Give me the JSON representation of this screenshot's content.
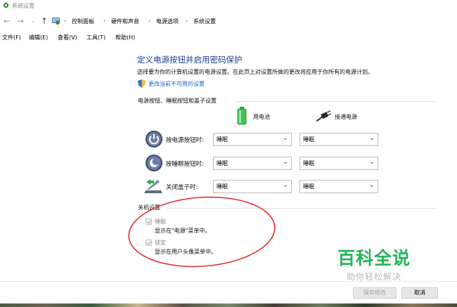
{
  "window": {
    "title": "系统设置"
  },
  "breadcrumb": [
    "控制面板",
    "硬件和声音",
    "电源选项",
    "系统设置"
  ],
  "menu": [
    "文件(F)",
    "编辑(E)",
    "查看(V)",
    "工具(T)",
    "帮助(H)"
  ],
  "main": {
    "heading": "定义电源按钮并启用密码保护",
    "description": "选择要为你的计算机设置的电源设置。在此页上对设置所做的更改将应用于你所有的电源计划。",
    "change_link": "更改当前不可用的设置"
  },
  "buttons_section": {
    "title": "电源按钮、睡眠按钮和盖子设置",
    "battery_label": "用电池",
    "plugged_label": "接通电源",
    "rows": [
      {
        "label": "按电源按钮时:",
        "battery": "睡眠",
        "plugged": "睡眠",
        "icon": "power-icon"
      },
      {
        "label": "按睡眠按钮时:",
        "battery": "睡眠",
        "plugged": "睡眠",
        "icon": "sleep-icon"
      },
      {
        "label": "关闭盖子时:",
        "battery": "睡眠",
        "plugged": "睡眠",
        "icon": "lid-icon"
      }
    ]
  },
  "shutdown_section": {
    "title": "关机设置",
    "items": [
      {
        "label": "睡眠",
        "desc": "显示在\"电源\"菜单中。",
        "checked": true,
        "enabled": false
      },
      {
        "label": "锁定",
        "desc": "显示在用户头像菜单中。",
        "checked": true,
        "enabled": false
      }
    ]
  },
  "footer": {
    "save_label": "保存修改",
    "cancel_label": "取消"
  },
  "watermark": {
    "big": "百科全说",
    "small": "助你轻松解决"
  },
  "colors": {
    "heading": "#1e3d8a",
    "link": "#1c64c9",
    "annotation": "#e03030",
    "watermark": "#26b35a"
  }
}
